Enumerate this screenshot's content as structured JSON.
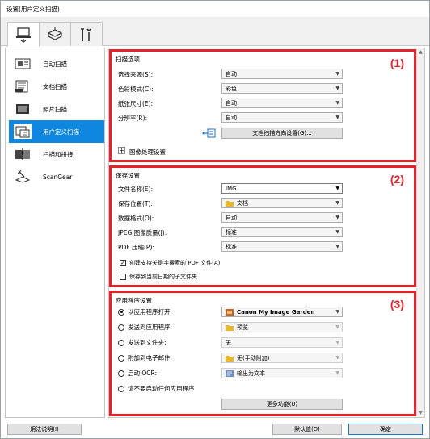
{
  "window": {
    "title": "设置(用户定义扫描)"
  },
  "tooltabs": [
    {
      "name": "scan-from-computer-tab",
      "icon": "computer-scan-icon"
    },
    {
      "name": "scan-from-panel-tab",
      "icon": "scanner-icon"
    },
    {
      "name": "general-settings-tab",
      "icon": "tools-icon"
    }
  ],
  "sidebar": {
    "items": [
      {
        "label": "自动扫描",
        "icon": "auto-scan-icon"
      },
      {
        "label": "文档扫描",
        "icon": "document-scan-icon"
      },
      {
        "label": "照片扫描",
        "icon": "photo-scan-icon"
      },
      {
        "label": "用户定义扫描",
        "icon": "custom-scan-icon"
      },
      {
        "label": "扫描和拼接",
        "icon": "stitch-scan-icon"
      },
      {
        "label": "ScanGear",
        "icon": "scangear-icon"
      }
    ],
    "active_index": 3
  },
  "scan_options": {
    "title": "扫描选项",
    "number": "(1)",
    "source_label": "选择来源(S):",
    "source_value": "自动",
    "color_label": "色彩模式(C):",
    "color_value": "彩色",
    "paper_label": "纸张尺寸(E):",
    "paper_value": "自动",
    "resolution_label": "分辨率(R):",
    "resolution_value": "自动",
    "orientation_button": "文档扫描方向设置(G)...",
    "image_processing_label": "图像处理设置"
  },
  "save_settings": {
    "title": "保存设置",
    "number": "(2)",
    "filename_label": "文件名称(E):",
    "filename_value": "IMG",
    "location_label": "保存位置(T):",
    "location_value": "文档",
    "format_label": "数据格式(O):",
    "format_value": "自动",
    "jpeg_label": "JPEG 图像质量(J):",
    "jpeg_value": "标准",
    "pdf_label": "PDF 压缩(P):",
    "pdf_value": "标准",
    "searchable_pdf_label": "创建支持关键字搜索的 PDF 文件(A)",
    "searchable_pdf_checked": true,
    "subfolder_label": "保存到当前日期的子文件夹",
    "subfolder_checked": false
  },
  "app_settings": {
    "title": "应用程序设置",
    "number": "(3)",
    "options": [
      {
        "label": "以应用程序打开:",
        "value": "Canon My Image Garden",
        "selected": true,
        "enabled": true
      },
      {
        "label": "发送到应用程序:",
        "value": "预览",
        "selected": false,
        "enabled": false
      },
      {
        "label": "发送到文件夹:",
        "value": "无",
        "selected": false,
        "enabled": false
      },
      {
        "label": "附加到电子邮件:",
        "value": "无(手动附加)",
        "selected": false,
        "enabled": false
      },
      {
        "label": "启动 OCR:",
        "value": "输出为文本",
        "selected": false,
        "enabled": false
      },
      {
        "label": "请不要启动任何应用程序",
        "value": "",
        "selected": false,
        "enabled": true
      }
    ],
    "more_button": "更多功能(U)"
  },
  "footer": {
    "instructions_button": "用法说明(I)",
    "defaults_button": "默认值(D)",
    "ok_button": "确定"
  },
  "colors": {
    "highlight": "#e8202a",
    "selected": "#0f87e0"
  }
}
